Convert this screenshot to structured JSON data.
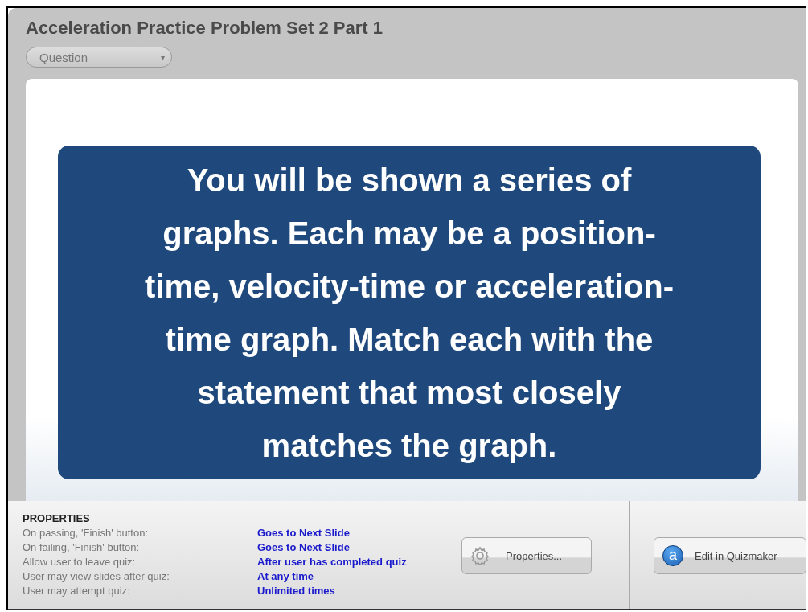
{
  "title": "Acceleration Practice Problem Set 2 Part 1",
  "view_select": {
    "value": "Question",
    "caret": "▾"
  },
  "slide": {
    "text": "You will be shown a series of\ngraphs.  Each may be a position-\ntime, velocity-time or acceleration-\ntime graph.  Match each with the\nstatement that most closely\nmatches the graph."
  },
  "properties": {
    "heading": "PROPERTIES",
    "rows": [
      {
        "label": "On passing, 'Finish' button:",
        "value": "Goes to Next Slide"
      },
      {
        "label": "On failing, 'Finish' button:",
        "value": "Goes to Next Slide"
      },
      {
        "label": "Allow user to leave quiz:",
        "value": "After user has completed quiz"
      },
      {
        "label": "User may view slides after quiz:",
        "value": "At any time"
      },
      {
        "label": "User may attempt quiz:",
        "value": "Unlimited times"
      }
    ]
  },
  "buttons": [
    {
      "kind": "properties",
      "label": "Properties..."
    },
    {
      "kind": "quizmaker",
      "label": "Edit in Quizmaker",
      "logo_letter": "a"
    }
  ]
}
